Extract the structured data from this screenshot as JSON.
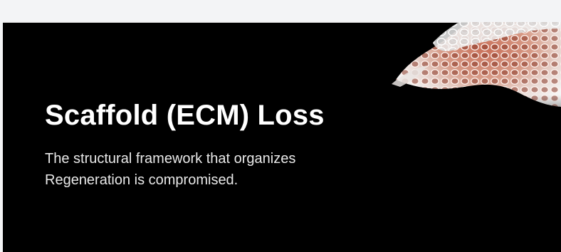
{
  "card": {
    "title": "Scaffold (ECM) Loss",
    "description_lines": [
      "The structural framework that organizes",
      "Regeneration is compromised."
    ]
  },
  "image": {
    "icon": "honeycomb-scaffold-image"
  },
  "colors": {
    "page_background": "#f3f4f6",
    "card_background": "#000000",
    "title_text": "#ffffff",
    "body_text": "#e9e9e9"
  }
}
